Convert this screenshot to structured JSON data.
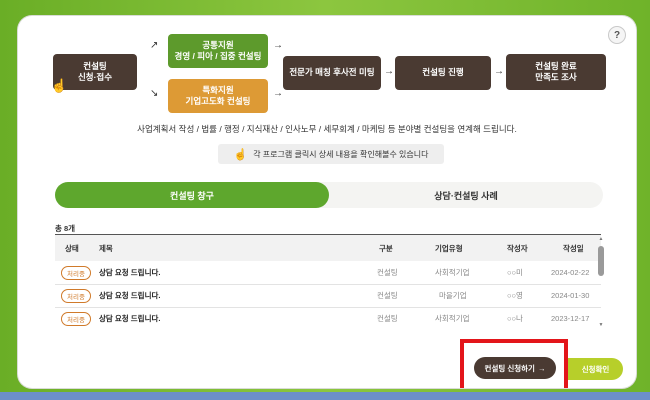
{
  "help_label": "?",
  "flow": {
    "step1": [
      "컨설팅",
      "신청·접수"
    ],
    "common": [
      "공통지원",
      "경영 / 피아 / 집중 컨설팅"
    ],
    "special": [
      "특화지원",
      "기업고도화 컨설팅"
    ],
    "step3": "전문가 매칭 후사전 미팅",
    "step4": "컨설팅 진행",
    "step5": [
      "컨설팅 완료",
      "만족도 조사"
    ]
  },
  "description": "사업계획서 작성 / 법률 / 행정 / 지식재산 / 인사노무 / 세무회계 / 마케팅 등 분야별 컨설팅을 연계해 드립니다.",
  "notice": "각 프로그램 클릭시 상세 내용을 확인해볼수 있습니다",
  "tabs": [
    "컨설팅 창구",
    "상담·컨설팅 사례"
  ],
  "total_count": "총 8개",
  "table": {
    "headers": [
      "상태",
      "제목",
      "구분",
      "기업유형",
      "작성자",
      "작성일"
    ],
    "rows": [
      {
        "status": "처리중",
        "title": "상담 요청 드립니다.",
        "type": "컨설팅",
        "company": "사회적기업",
        "author": "○○미",
        "date": "2024-02-22"
      },
      {
        "status": "처리중",
        "title": "상담 요청 드립니다.",
        "type": "컨설팅",
        "company": "마을기업",
        "author": "○○영",
        "date": "2024-01-30"
      },
      {
        "status": "처리중",
        "title": "상담 요청 드립니다.",
        "type": "컨설팅",
        "company": "사회적기업",
        "author": "○○나",
        "date": "2023-12-17"
      }
    ]
  },
  "buttons": {
    "apply": "컨설팅 신청하기",
    "apply_arrow": "→",
    "check": "신청확인"
  }
}
